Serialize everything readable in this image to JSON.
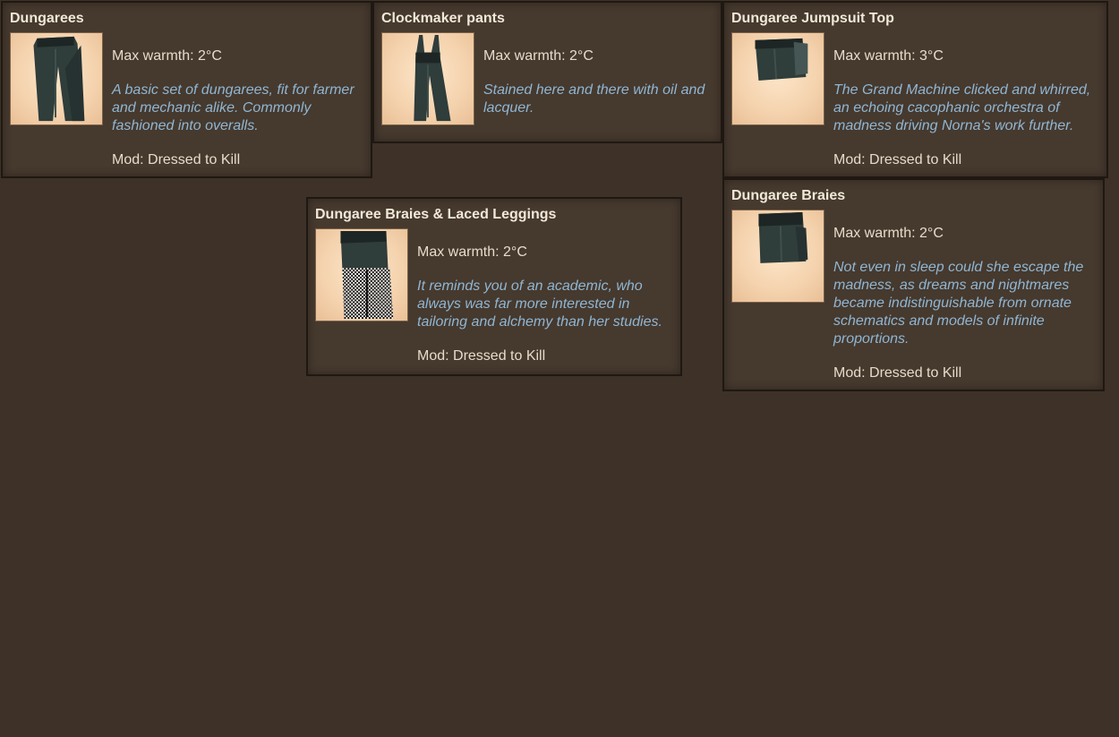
{
  "colors": {
    "background": "#3d3128",
    "panel": "#46392e",
    "title": "#f1e8d8",
    "text": "#e6dccb",
    "description": "#8fb6d3"
  },
  "tooltips": [
    {
      "title": "Dungarees",
      "icon": "dungarees-item-icon",
      "warmth": "Max warmth: 2°C",
      "description": "A basic set of dungarees, fit for farmer and mechanic alike. Commonly fashioned into overalls.",
      "mod": "Mod: Dressed to Kill"
    },
    {
      "title": "Clockmaker pants",
      "icon": "clockmaker-pants-item-icon",
      "warmth": "Max warmth: 2°C",
      "description": "Stained here and there with oil and lacquer.",
      "mod": ""
    },
    {
      "title": "Dungaree Jumpsuit Top",
      "icon": "jumpsuit-top-item-icon",
      "warmth": "Max warmth: 3°C",
      "description": "The Grand Machine clicked and whirred, an echoing cacophanic orchestra of madness driving Norna's work further.",
      "mod": "Mod: Dressed to Kill"
    },
    {
      "title": "Dungaree Braies",
      "icon": "dungaree-braies-item-icon",
      "warmth": "Max warmth: 2°C",
      "description": "Not even in sleep could she escape the madness, as dreams and nightmares became indistinguishable from ornate schematics and models of infinite proportions.",
      "mod": "Mod: Dressed to Kill"
    },
    {
      "title": "Dungaree Braies & Laced Leggings",
      "icon": "braies-laced-leggings-item-icon",
      "warmth": "Max warmth: 2°C",
      "description": "It reminds you of an academic, who always was far more interested in tailoring and alchemy than her studies.",
      "mod": "Mod: Dressed to Kill"
    }
  ]
}
